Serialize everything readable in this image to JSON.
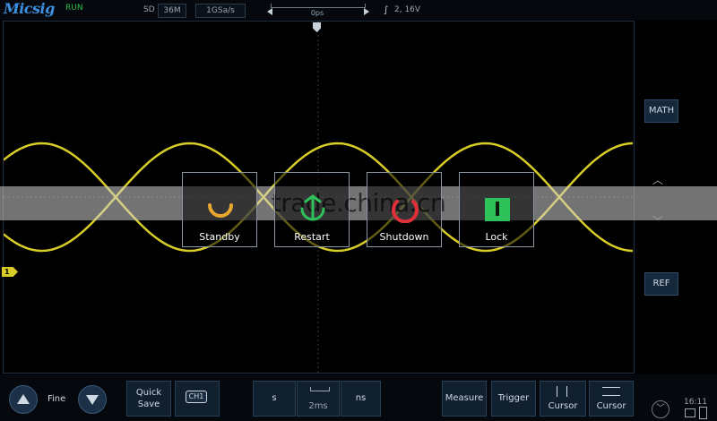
{
  "header": {
    "brand": "Micsig",
    "run_state": "RUN",
    "mode": "SD",
    "memory_depth": "36M",
    "sample_rate": "1GSa/s",
    "time_offset": "0ps",
    "trigger_info": "2, 16V",
    "trigger_icon": "rising-edge-icon"
  },
  "screen": {
    "channel_marker": "1",
    "trace_color": "#d8cc28",
    "watermark": "trade.china.cn"
  },
  "power_dialog": {
    "buttons": [
      {
        "label": "Standby",
        "icon": "standby-icon",
        "color": "#e8a830"
      },
      {
        "label": "Restart",
        "icon": "restart-icon",
        "color": "#2fc25a"
      },
      {
        "label": "Shutdown",
        "icon": "power-icon",
        "color": "#e0303a"
      },
      {
        "label": "Lock",
        "icon": "lock-icon",
        "color": "#2fc25a"
      }
    ]
  },
  "side_panel": {
    "math_label": "MATH",
    "ref_label": "REF"
  },
  "bottom": {
    "fine_label": "Fine",
    "quick_save_line1": "Quick",
    "quick_save_line2": "Save",
    "ch1_label": "CH1",
    "s_label": "s",
    "timebase": "2ms",
    "ns_label": "ns",
    "measure_label": "Measure",
    "trigger_label": "Trigger",
    "cursor1_label": "Cursor",
    "cursor2_label": "Cursor",
    "clock": "16:11"
  }
}
